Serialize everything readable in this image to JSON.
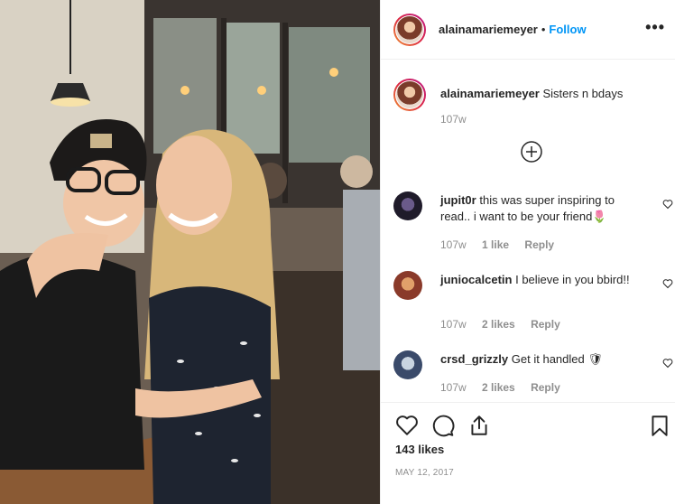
{
  "post": {
    "author": "alainamariemeyer",
    "separator": "•",
    "follow_label": "Follow",
    "more_label": "•••",
    "caption_text": "Sisters n bdays",
    "caption_age": "107w",
    "likes_label": "143 likes",
    "date": "MAY 12, 2017"
  },
  "comments": [
    {
      "user": "jupit0r",
      "text": "this was super inspiring to read.. i want to be your friend",
      "emoji": "🌷",
      "age": "107w",
      "likes": "1 like",
      "reply": "Reply"
    },
    {
      "user": "juniocalcetin",
      "text": "I believe in you bbird!!",
      "emoji": "",
      "age": "107w",
      "likes": "2 likes",
      "reply": "Reply"
    },
    {
      "user": "crsd_grizzly",
      "text": "Get it handled",
      "emoji": "🛡",
      "age": "107w",
      "likes": "2 likes",
      "reply": "Reply"
    }
  ],
  "icons": {
    "like": "heart-icon",
    "comment": "comment-bubble-icon",
    "share": "share-icon",
    "save": "bookmark-icon",
    "load_more": "plus-circle-icon",
    "comment_like": "small-heart-icon"
  },
  "colors": {
    "link_blue": "#0095f6",
    "text": "#262626",
    "muted": "#8e8e8e",
    "divider": "#efefef"
  }
}
